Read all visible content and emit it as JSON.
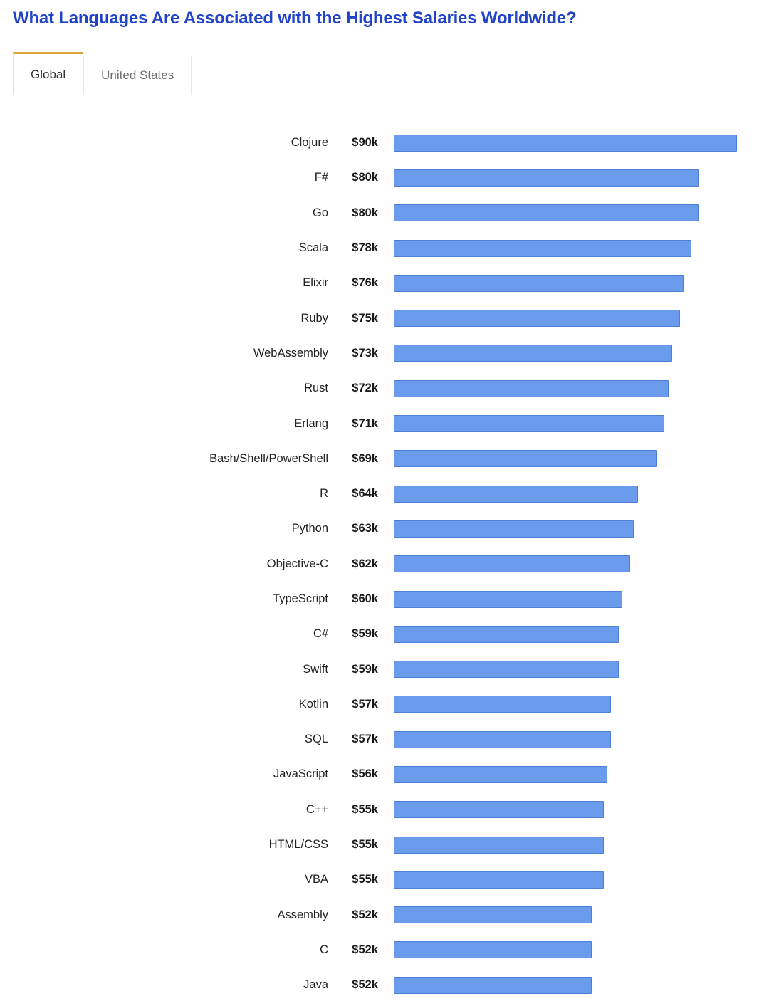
{
  "header": {
    "title": "What Languages Are Associated with the Highest Salaries Worldwide?",
    "title_color": "#2143c8"
  },
  "tabs": {
    "active_index": 0,
    "accent_color": "#e0a33c",
    "items": [
      {
        "label": "Global",
        "active": true
      },
      {
        "label": "United States",
        "active": false
      }
    ]
  },
  "chart_data": {
    "type": "bar",
    "orientation": "horizontal",
    "title": "What Languages Are Associated with the Highest Salaries Worldwide?",
    "xlabel": "",
    "ylabel": "",
    "xlim": [
      0,
      90
    ],
    "grid": false,
    "legend": null,
    "unit": "k USD",
    "bar_color": "#6b9bed",
    "bar_border_color": "#4a7fd4",
    "categories": [
      "Clojure",
      "F#",
      "Go",
      "Scala",
      "Elixir",
      "Ruby",
      "WebAssembly",
      "Rust",
      "Erlang",
      "Bash/Shell/PowerShell",
      "R",
      "Python",
      "Objective-C",
      "TypeScript",
      "C#",
      "Swift",
      "Kotlin",
      "SQL",
      "JavaScript",
      "C++",
      "HTML/CSS",
      "VBA",
      "Assembly",
      "C",
      "Java"
    ],
    "values": [
      90,
      80,
      80,
      78,
      76,
      75,
      73,
      72,
      71,
      69,
      64,
      63,
      62,
      60,
      59,
      59,
      57,
      57,
      56,
      55,
      55,
      55,
      52,
      52,
      52
    ],
    "value_labels": [
      "$90k",
      "$80k",
      "$80k",
      "$78k",
      "$76k",
      "$75k",
      "$73k",
      "$72k",
      "$71k",
      "$69k",
      "$64k",
      "$63k",
      "$62k",
      "$60k",
      "$59k",
      "$59k",
      "$57k",
      "$57k",
      "$56k",
      "$55k",
      "$55k",
      "$55k",
      "$52k",
      "$52k",
      "$52k"
    ]
  }
}
